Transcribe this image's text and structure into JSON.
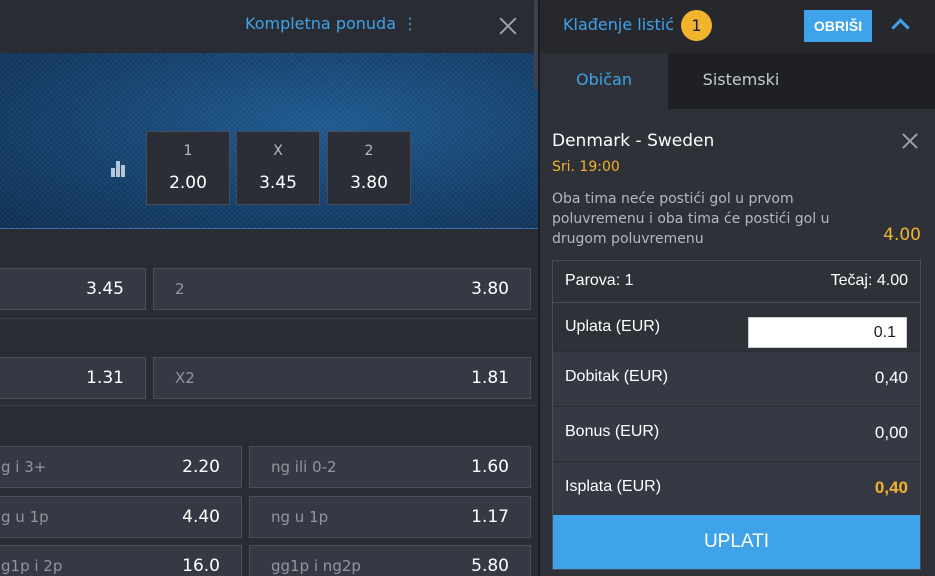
{
  "left_header": {
    "full_offer_label": "Kompletna ponuda",
    "menu_glyph": "⋮"
  },
  "main_odds": [
    {
      "label": "1",
      "value": "2.00"
    },
    {
      "label": "X",
      "value": "3.45"
    },
    {
      "label": "2",
      "value": "3.80"
    }
  ],
  "markets": {
    "row1": [
      {
        "label": "",
        "value": "3.45"
      },
      {
        "label": "2",
        "value": "3.80"
      }
    ],
    "row2": [
      {
        "label": "",
        "value": "1.31"
      },
      {
        "label": "X2",
        "value": "1.81"
      }
    ],
    "row3": [
      {
        "label": "g i 3+",
        "value": "2.20"
      },
      {
        "label": "ng ili 0-2",
        "value": "1.60"
      }
    ],
    "row4": [
      {
        "label": "g u 1p",
        "value": "4.40"
      },
      {
        "label": "ng u 1p",
        "value": "1.17"
      }
    ],
    "row5": [
      {
        "label": "g1p i 2p",
        "value": "16.0"
      },
      {
        "label": "gg1p i ng2p",
        "value": "5.80"
      }
    ]
  },
  "betslip": {
    "title": "Klađenje listić",
    "count": "1",
    "clear_label": "OBRIŠI",
    "tabs": [
      "Običan",
      "Sistemski"
    ],
    "match": "Denmark - Sweden",
    "time": "Sri. 19:00",
    "selection": "Oba tima neće postići gol u prvom poluvremenu i oba tima će postići gol u drugom poluvremenu",
    "selection_odd": "4.00",
    "pairs_label": "Parova: 1",
    "odds_label": "Tečaj: 4.00",
    "stake_label": "Uplata (EUR)",
    "stake_value": "0.1",
    "win_label": "Dobitak (EUR)",
    "win_value": "0,40",
    "bonus_label": "Bonus (EUR)",
    "bonus_value": "0,00",
    "payout_label": "Isplata (EUR)",
    "payout_value": "0,40",
    "submit_label": "UPLATI"
  },
  "colors": {
    "accent_blue": "#3fa3ea",
    "accent_yellow": "#f2b42d",
    "panel_dark": "#2e3138"
  }
}
